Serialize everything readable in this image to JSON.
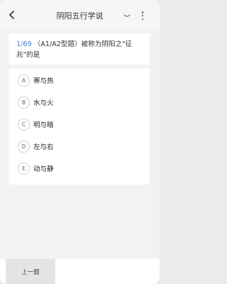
{
  "header": {
    "title": "阴阳五行学说"
  },
  "question": {
    "counter": "1/69",
    "text": "（A1/A2型题）被称为阴阳之\"征兆\"的是"
  },
  "options": [
    {
      "letter": "A",
      "text": "寒与热"
    },
    {
      "letter": "B",
      "text": "水与火"
    },
    {
      "letter": "C",
      "text": "明与暗"
    },
    {
      "letter": "D",
      "text": "左与右"
    },
    {
      "letter": "E",
      "text": "动与静"
    }
  ],
  "footer": {
    "prev_label": "上一题"
  },
  "colors": {
    "accent": "#3f7fd0",
    "background": "#f2f2f2"
  }
}
